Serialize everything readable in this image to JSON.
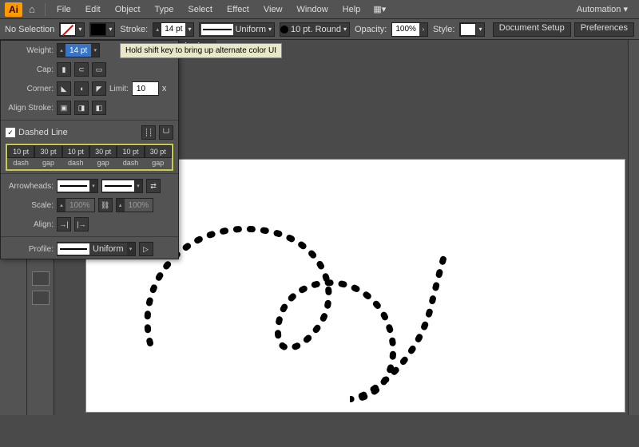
{
  "menubar": {
    "logo": "Ai",
    "items": [
      "File",
      "Edit",
      "Object",
      "Type",
      "Select",
      "Effect",
      "View",
      "Window",
      "Help"
    ],
    "automation": "Automation"
  },
  "controlbar": {
    "selection": "No Selection",
    "stroke_label": "Stroke:",
    "stroke_weight": "14 pt",
    "profile_label": "Uniform",
    "brush_label": "10 pt. Round",
    "opacity_label": "Opacity:",
    "opacity_value": "100%",
    "style_label": "Style:",
    "btn_docsetup": "Document Setup",
    "btn_prefs": "Preferences"
  },
  "tooltip": "Hold shift key to bring up alternate color UI",
  "tab": {
    "label": "review)",
    "close": "×"
  },
  "stroke_panel": {
    "weight_label": "Weight:",
    "weight_value": "14 pt",
    "cap_label": "Cap:",
    "corner_label": "Corner:",
    "limit_label": "Limit:",
    "limit_value": "10",
    "limit_x": "x",
    "align_label": "Align Stroke:",
    "dashed_label": "Dashed Line",
    "dashed_checked": "✓",
    "dashes": [
      {
        "v": "10 pt",
        "l": "dash"
      },
      {
        "v": "30 pt",
        "l": "gap"
      },
      {
        "v": "10 pt",
        "l": "dash"
      },
      {
        "v": "30 pt",
        "l": "gap"
      },
      {
        "v": "10 pt",
        "l": "dash"
      },
      {
        "v": "30 pt",
        "l": "gap"
      }
    ],
    "arrow_label": "Arrowheads:",
    "scale_label": "Scale:",
    "scale_v1": "100%",
    "scale_v2": "100%",
    "align_arrow_label": "Align:",
    "profile_label": "Profile:",
    "profile_value": "Uniform"
  }
}
